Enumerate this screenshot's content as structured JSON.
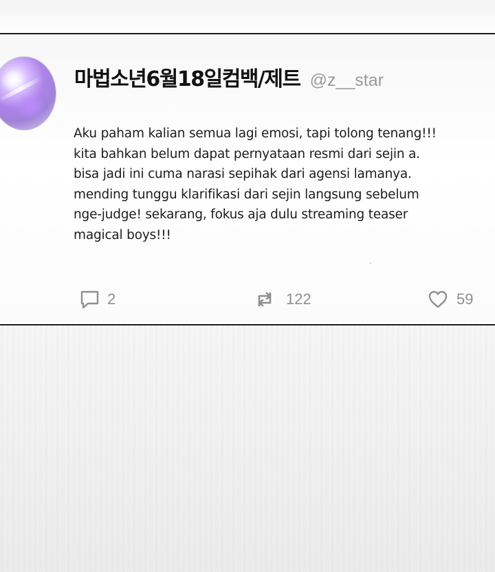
{
  "post": {
    "display_name": "마법소년6월18일컴백/제트",
    "handle": "@z__star",
    "avatar_icon": "profile-avatar-purple-glow",
    "body_lines": [
      "Aku paham kalian semua lagi emosi, tapi tolong tenang!!!",
      "kita bahkan belum dapat pernyataan resmi dari sejin a.",
      "bisa jadi ini cuma narasi sepihak dari agensi lamanya.",
      "mending tunggu klarifikasi dari sejin langsung sebelum",
      "nge-judge! sekarang, fokus aja dulu streaming teaser",
      "magical boys!!!"
    ],
    "actions": {
      "reply": {
        "icon": "reply-icon",
        "count": "2"
      },
      "retweet": {
        "icon": "retweet-icon",
        "count": "122"
      },
      "like": {
        "icon": "heart-icon",
        "count": "59"
      }
    }
  },
  "colors": {
    "border": "#1a1a1a",
    "text": "#1c1c1c",
    "muted": "#8f8f8f",
    "handle": "#9a9a9a"
  }
}
